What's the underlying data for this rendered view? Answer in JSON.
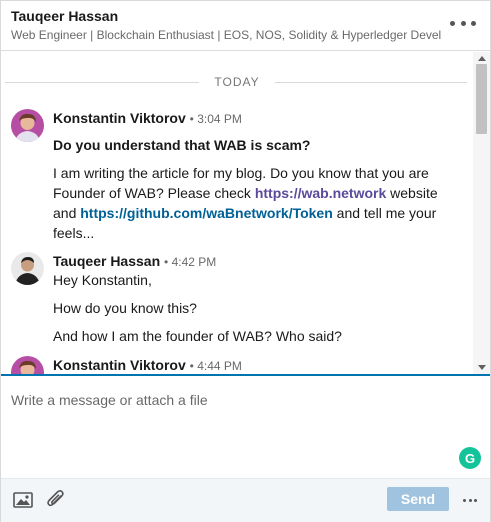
{
  "header": {
    "name": "Tauqeer Hassan",
    "headline": "Web Engineer | Blockchain Enthusiast | EOS, NOS, Solidity & Hyperledger Devel...",
    "more_icon": "more-horizontal-icon"
  },
  "divider": {
    "label": "TODAY"
  },
  "groups": [
    {
      "author": "Konstantin Viktorov",
      "time": "3:04 PM",
      "messages": {
        "m1": "Do you understand that WAB is scam?",
        "m2_text1": "I am writing the article for my blog. Do you know that you are Founder of WAB? Please check ",
        "m2_link1": "https://wab.network",
        "m2_text2": " website and ",
        "m2_link2": "https://github.com/waBnetwork/Token",
        "m2_text3": " and tell me your feels..."
      }
    },
    {
      "author": "Tauqeer Hassan",
      "time": "4:42 PM",
      "messages": {
        "m1": "Hey Konstantin,",
        "m2": "How do you know this?",
        "m3": "And how I am the founder of WAB? Who said?"
      }
    },
    {
      "author": "Konstantin Viktorov",
      "time": "4:44 PM"
    }
  ],
  "compose": {
    "placeholder": "Write a message or attach a file",
    "send_label": "Send",
    "image_icon": "image-icon",
    "attach_icon": "paperclip-icon",
    "grammarly_icon": "grammarly-icon",
    "grammarly_letter": "G"
  },
  "colors": {
    "accent": "#0073b1",
    "link": "#006097",
    "visited_link": "#5b4a9b",
    "send_disabled": "#a0c4df",
    "grammarly": "#15c39a"
  }
}
